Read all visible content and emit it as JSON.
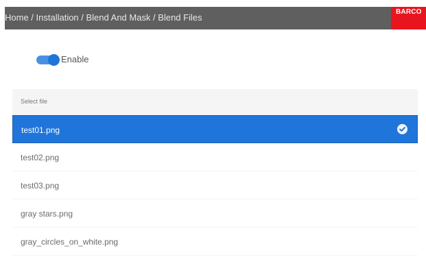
{
  "header": {
    "breadcrumb": "Home / Installation / Blend And Mask / Blend Files",
    "logo": "BARCO"
  },
  "toggle": {
    "label": "Enable",
    "state": "on"
  },
  "file_list": {
    "header": "Select file",
    "items": [
      {
        "name": "test01.png",
        "selected": true
      },
      {
        "name": "test02.png",
        "selected": false
      },
      {
        "name": "test03.png",
        "selected": false
      },
      {
        "name": "gray stars.png",
        "selected": false
      },
      {
        "name": "gray_circles_on_white.png",
        "selected": false
      }
    ]
  },
  "colors": {
    "header_bg": "#5f5f5f",
    "logo_bg": "#e8151e",
    "accent": "#1f75d9"
  },
  "icons": {
    "selected": "check-circle-icon"
  }
}
